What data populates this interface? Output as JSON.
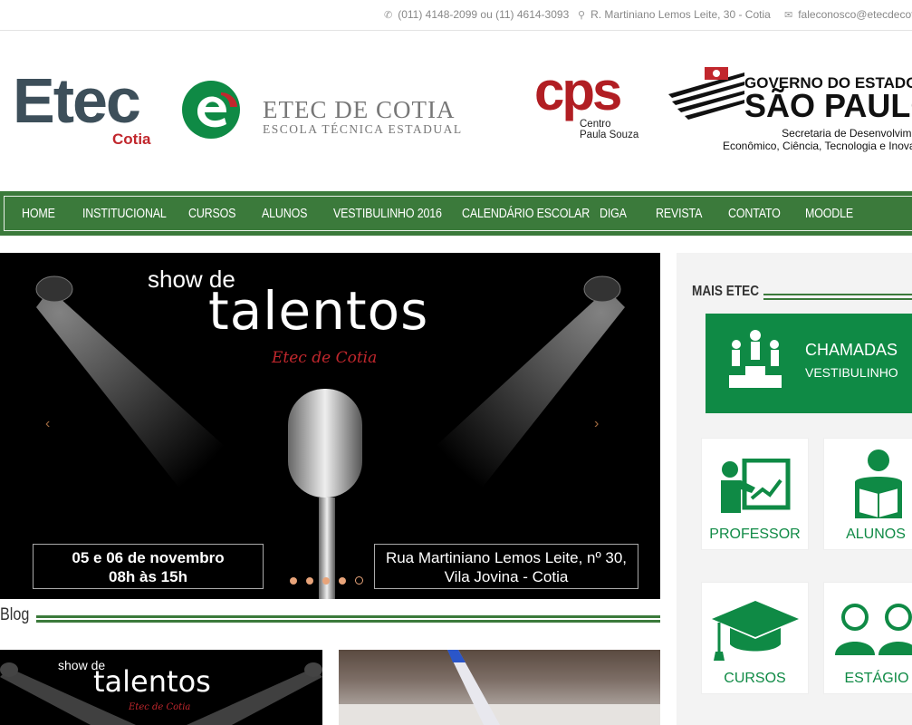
{
  "topbar": {
    "phone": "(011) 4148-2099 ou (11) 4614-3093",
    "address": "R. Martiniano Lemos Leite, 30 - Cotia",
    "email": "faleconosco@etecdecotia"
  },
  "brand": {
    "etec": "Etec",
    "etec_sub": "Cotia",
    "cotia_line1": "ETEC DE COTIA",
    "cotia_line2": "ESCOLA TÉCNICA ESTADUAL",
    "cps": "cps",
    "cps_line1": "Centro",
    "cps_line2": "Paula Souza",
    "gov_line1": "GOVERNO DO ESTADO",
    "gov_line2": "SÃO PAULO",
    "gov_line3": "Secretaria de Desenvolvimento",
    "gov_line4": "Econômico, Ciência, Tecnologia e Inovação"
  },
  "nav": {
    "items": [
      {
        "label": "HOME"
      },
      {
        "label": "INSTITUCIONAL"
      },
      {
        "label": "CURSOS"
      },
      {
        "label": "ALUNOS"
      },
      {
        "label": "VESTIBULINHO 2016"
      },
      {
        "label": "CALENDÁRIO ESCOLAR"
      },
      {
        "label": "DIGA"
      },
      {
        "label": "REVISTA"
      },
      {
        "label": "CONTATO"
      },
      {
        "label": "MOODLE"
      }
    ]
  },
  "slider": {
    "title1": "show de",
    "title2": "talentos",
    "title3": "Etec de Cotia",
    "date1": "05 e 06 de novembro",
    "date2": "08h às 15h",
    "addr1": "Rua Martiniano Lemos Leite, nº 30,",
    "addr2": "Vila Jovina - Cotia",
    "prev": "‹",
    "next": "›",
    "slides": 5,
    "active_slide": 4
  },
  "blog": {
    "heading": "Blog",
    "thumb1_title1": "show de",
    "thumb1_title2": "talentos",
    "thumb1_title3": "Etec de Cotia"
  },
  "sidebar": {
    "heading": "MAIS ETEC",
    "chamadas_line1": "CHAMADAS",
    "chamadas_line2": "VESTIBULINHO",
    "tiles": {
      "professor": "PROFESSOR",
      "alunos": "ALUNOS",
      "cursos": "CURSOS",
      "estagio": "ESTÁGIO"
    }
  },
  "colors": {
    "nav_green": "#3b7a3b",
    "brand_green": "#0f8a45",
    "brand_red": "#c1272d"
  }
}
